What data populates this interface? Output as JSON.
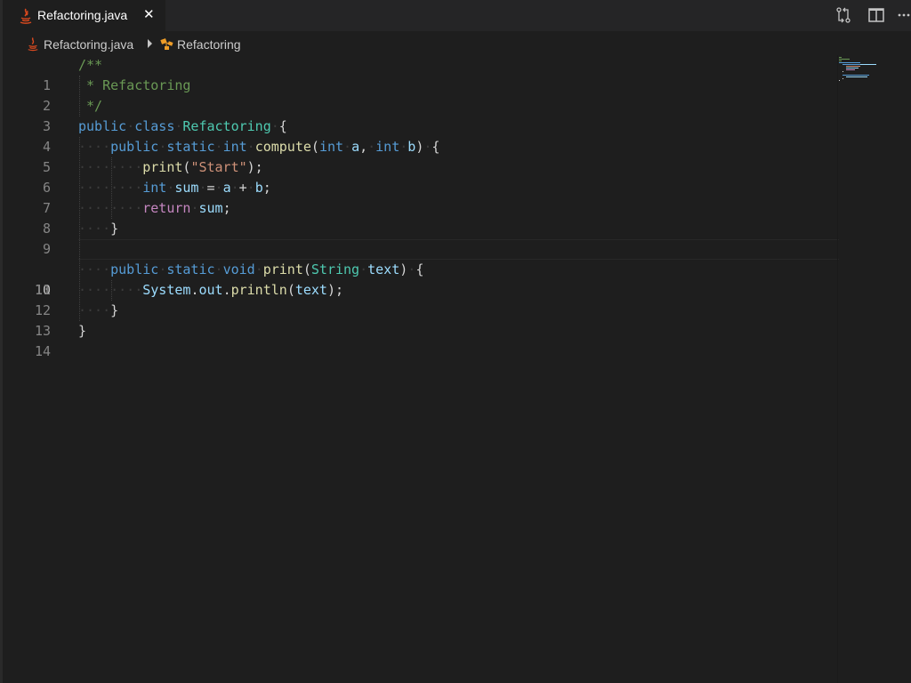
{
  "tab": {
    "label": "Refactoring.java",
    "close_glyph": "✕",
    "file_icon": "java-file-icon"
  },
  "actions": [
    {
      "name": "open-changes-icon"
    },
    {
      "name": "split-editor-icon"
    },
    {
      "name": "more-actions-icon"
    }
  ],
  "breadcrumb": {
    "file": "Refactoring.java",
    "symbol": "Refactoring",
    "file_icon": "java-file-icon",
    "symbol_icon": "class-icon"
  },
  "editor": {
    "current_line": 10,
    "line_numbers": [
      "1",
      "2",
      "3",
      "4",
      "5",
      "6",
      "7",
      "8",
      "9",
      "10",
      "11",
      "12",
      "13",
      "14"
    ],
    "lines": [
      "/**",
      " * Refactoring",
      " */",
      "public class Refactoring {",
      "    public static int compute(int a, int b) {",
      "        print(\"Start\");",
      "        int sum = a + b;",
      "        return sum;",
      "    }",
      "",
      "    public static void print(String text) {",
      "        System.out.println(text);",
      "    }",
      "}"
    ]
  },
  "colors": {
    "background": "#1e1e1e",
    "tab_bar": "#252526",
    "keyword": "#569cd6",
    "control": "#c586c0",
    "type": "#4ec9b0",
    "function": "#dcdcaa",
    "variable": "#9cdcfe",
    "string": "#ce9178",
    "comment": "#6a9955",
    "java_icon": "#d9491f",
    "class_icon": "#ee9d28"
  }
}
